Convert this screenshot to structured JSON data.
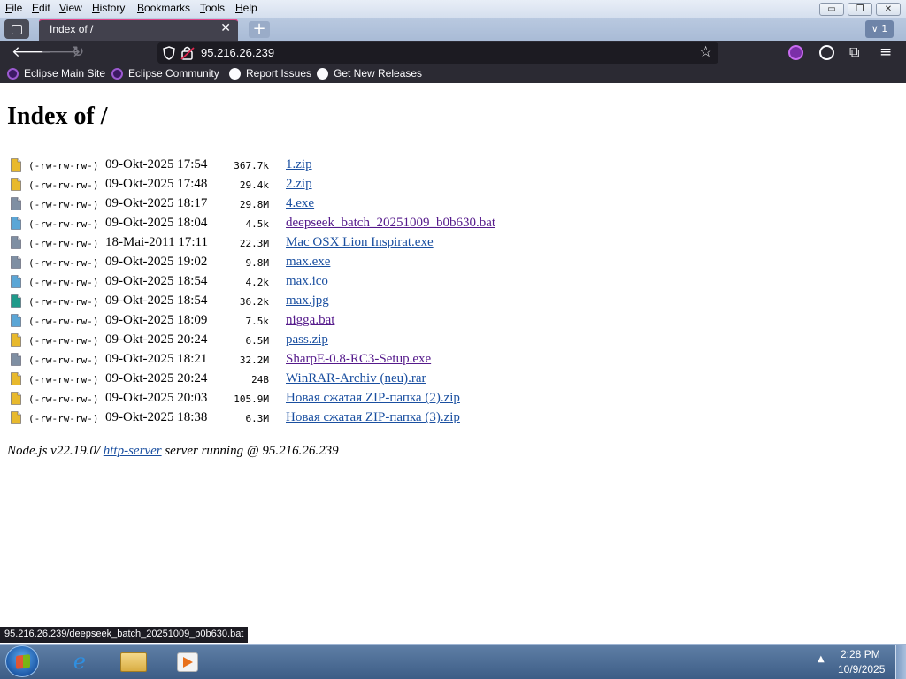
{
  "menu": [
    "File",
    "Edit",
    "View",
    "History",
    "Bookmarks",
    "Tools",
    "Help"
  ],
  "window_controls": {
    "minimize": "▭",
    "restore": "❐",
    "close": "✕"
  },
  "tab": {
    "title": "Index of /",
    "close": "✕",
    "new_tab": "+",
    "all_tabs": "∨ 1"
  },
  "address": {
    "url": "95.216.26.239"
  },
  "bookmarks": [
    "Eclipse Main Site",
    "Eclipse Community",
    "Report Issues",
    "Get New Releases"
  ],
  "page": {
    "title": "Index of /",
    "files": [
      {
        "perm": "(-rw-rw-rw-)",
        "date": "09-Okt-2025 17:54",
        "size": "367.7k",
        "name": "1.zip",
        "type": "zip",
        "visited": false
      },
      {
        "perm": "(-rw-rw-rw-)",
        "date": "09-Okt-2025 17:48",
        "size": "29.4k",
        "name": "2.zip",
        "type": "zip",
        "visited": false
      },
      {
        "perm": "(-rw-rw-rw-)",
        "date": "09-Okt-2025 18:17",
        "size": "29.8M",
        "name": "4.exe",
        "type": "exe",
        "visited": false
      },
      {
        "perm": "(-rw-rw-rw-)",
        "date": "09-Okt-2025 18:04",
        "size": "4.5k",
        "name": "deepseek_batch_20251009_b0b630.bat",
        "type": "txt",
        "visited": true
      },
      {
        "perm": "(-rw-rw-rw-)",
        "date": "18-Mai-2011 17:11",
        "size": "22.3M",
        "name": "Mac OSX Lion Inspirat.exe",
        "type": "exe",
        "visited": false
      },
      {
        "perm": "(-rw-rw-rw-)",
        "date": "09-Okt-2025 19:02",
        "size": "9.8M",
        "name": "max.exe",
        "type": "exe",
        "visited": false
      },
      {
        "perm": "(-rw-rw-rw-)",
        "date": "09-Okt-2025 18:54",
        "size": "4.2k",
        "name": "max.ico",
        "type": "txt",
        "visited": false
      },
      {
        "perm": "(-rw-rw-rw-)",
        "date": "09-Okt-2025 18:54",
        "size": "36.2k",
        "name": "max.jpg",
        "type": "img",
        "visited": false
      },
      {
        "perm": "(-rw-rw-rw-)",
        "date": "09-Okt-2025 18:09",
        "size": "7.5k",
        "name": "nigga.bat",
        "type": "txt",
        "visited": true
      },
      {
        "perm": "(-rw-rw-rw-)",
        "date": "09-Okt-2025 20:24",
        "size": "6.5M",
        "name": "pass.zip",
        "type": "zip",
        "visited": false
      },
      {
        "perm": "(-rw-rw-rw-)",
        "date": "09-Okt-2025 18:21",
        "size": "32.2M",
        "name": "SharpE-0.8-RC3-Setup.exe",
        "type": "exe",
        "visited": true
      },
      {
        "perm": "(-rw-rw-rw-)",
        "date": "09-Okt-2025 20:24",
        "size": "24B",
        "name": "WinRAR-Archiv (neu).rar",
        "type": "zip",
        "visited": false
      },
      {
        "perm": "(-rw-rw-rw-)",
        "date": "09-Okt-2025 20:03",
        "size": "105.9M",
        "name": "Новая сжатая ZIP-папка (2).zip",
        "type": "zip",
        "visited": false
      },
      {
        "perm": "(-rw-rw-rw-)",
        "date": "09-Okt-2025 18:38",
        "size": "6.3M",
        "name": "Новая сжатая ZIP-папка (3).zip",
        "type": "zip",
        "visited": false
      }
    ],
    "footer": {
      "prefix": "Node.js v22.19.0/ ",
      "link": "http-server",
      "suffix": " server running @ 95.216.26.239"
    }
  },
  "status_tip": "95.216.26.239/deepseek_batch_20251009_b0b630.bat",
  "taskbar": {
    "time": "2:28 PM",
    "date": "10/9/2025"
  },
  "icon_colors": {
    "zip": "#e8b92c",
    "exe": "#7f8fa3",
    "txt": "#5ba6d6",
    "img": "#1f9a8a"
  }
}
